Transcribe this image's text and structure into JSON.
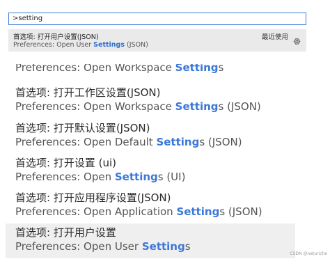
{
  "search": {
    "value": ">setting"
  },
  "top_item": {
    "title_cn": "首选项: 打开用户设置(JSON)",
    "desc_before": "Preferences: Open User ",
    "desc_highlight": "Settings",
    "desc_after": " (JSON)",
    "recent_label": "最近使用",
    "icon": "gear-icon"
  },
  "partial_item": {
    "desc_before": "Preferences: Open Workspace ",
    "desc_highlight": "Setting",
    "desc_after": "s"
  },
  "items": [
    {
      "title_cn": "首选项: 打开工作区设置(JSON)",
      "desc_before": "Preferences: Open Workspace ",
      "desc_highlight": "Setting",
      "desc_after": "s (JSON)"
    },
    {
      "title_cn": "首选项: 打开默认设置(JSON)",
      "desc_before": "Preferences: Open Default ",
      "desc_highlight": "Setting",
      "desc_after": "s (JSON)"
    },
    {
      "title_cn": "首选项: 打开设置 (ui)",
      "desc_before": "Preferences: Open ",
      "desc_highlight": "Setting",
      "desc_after": "s (UI)"
    },
    {
      "title_cn": "首选项: 打开应用程序设置(JSON)",
      "desc_before": "Preferences: Open Application ",
      "desc_highlight": "Setting",
      "desc_after": "s (JSON)"
    },
    {
      "title_cn": "首选项: 打开用户设置",
      "desc_before": "Preferences: Open User ",
      "desc_highlight": "Setting",
      "desc_after": "s"
    }
  ],
  "watermark": "CSDN @naturiche"
}
